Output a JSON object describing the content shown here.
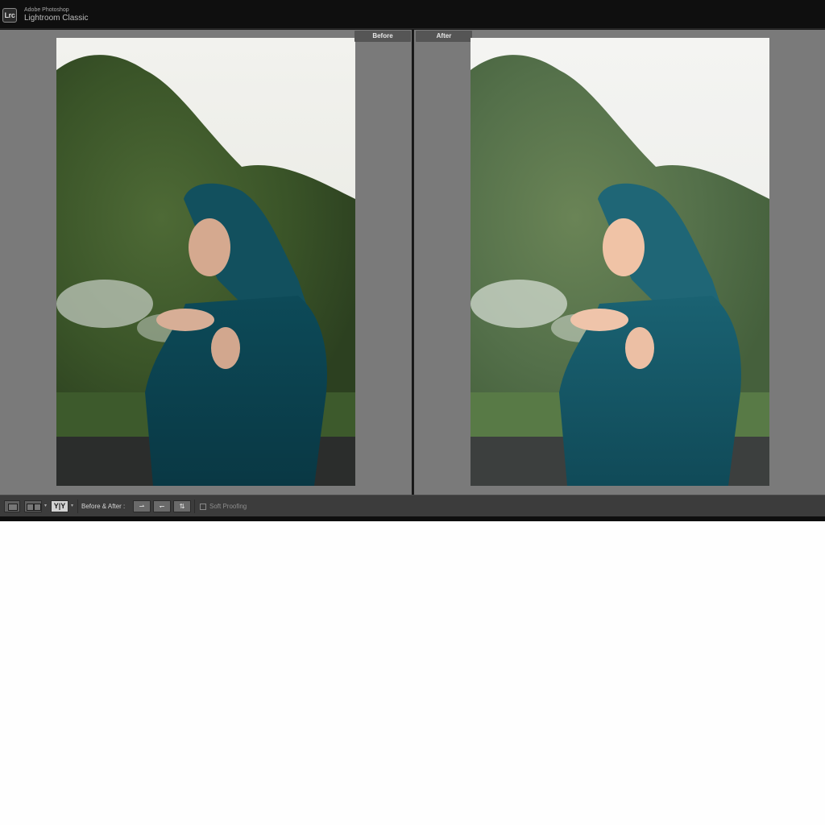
{
  "titlebar": {
    "logo_text": "Lrc",
    "vendor": "Adobe Photoshop",
    "product": "Lightroom Classic"
  },
  "compare": {
    "before_label": "Before",
    "after_label": "After"
  },
  "toolbar": {
    "yy_label": "Y|Y",
    "before_after_label": "Before & After :",
    "copy_before_to_after": "⇀",
    "copy_after_to_before": "↽",
    "swap": "⇅",
    "soft_proofing_label": "Soft Proofing",
    "soft_proofing_checked": false
  },
  "colors": {
    "panel_gray": "#7a7a7a",
    "toolbar": "#3c3c3c",
    "titlebar": "#0f0f0f"
  }
}
